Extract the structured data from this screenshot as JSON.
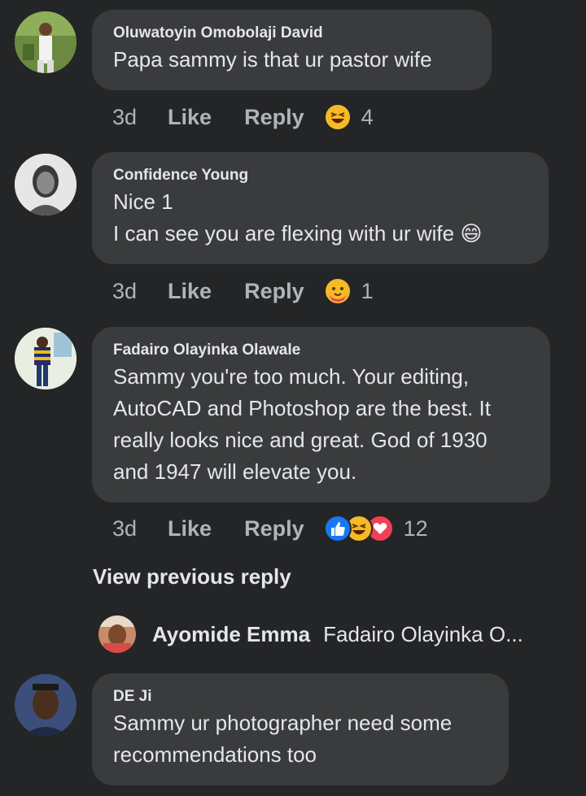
{
  "comments": [
    {
      "author": "Oluwatoyin Omobolaji David",
      "lines": [
        "Papa sammy is that ur pastor wife"
      ],
      "time": "3d",
      "like": "Like",
      "reply": "Reply",
      "reactions": [
        "laughing-emoji"
      ],
      "count": "4"
    },
    {
      "author": "Confidence Young",
      "lines": [
        "Nice 1",
        "I can see you are flexing with ur wife 😄"
      ],
      "time": "3d",
      "like": "Like",
      "reply": "Reply",
      "reactions": [
        "care-emoji"
      ],
      "count": "1"
    },
    {
      "author": "Fadairo Olayinka Olawale",
      "lines": [
        "Sammy you're too much. Your editing,",
        "AutoCAD and Photoshop are the best. It",
        "really looks nice and great. God of 1930",
        "and 1947 will elevate you."
      ],
      "time": "3d",
      "like": "Like",
      "reply": "Reply",
      "reactions": [
        "like-thumb",
        "laughing-emoji",
        "love-heart"
      ],
      "count": "12"
    },
    {
      "author": "DE Ji",
      "lines": [
        "Sammy ur photographer need some",
        "recommendations too"
      ]
    }
  ],
  "view_previous": "View previous reply",
  "reply_preview": {
    "author": "Ayomide Emma",
    "snippet": "Fadairo Olayinka O..."
  },
  "colors": {
    "background": "#242526",
    "bubble": "#3a3b3c",
    "like_blue": "#1877f2",
    "love_red": "#f33e58",
    "haha_yellow": "#f7b928"
  }
}
